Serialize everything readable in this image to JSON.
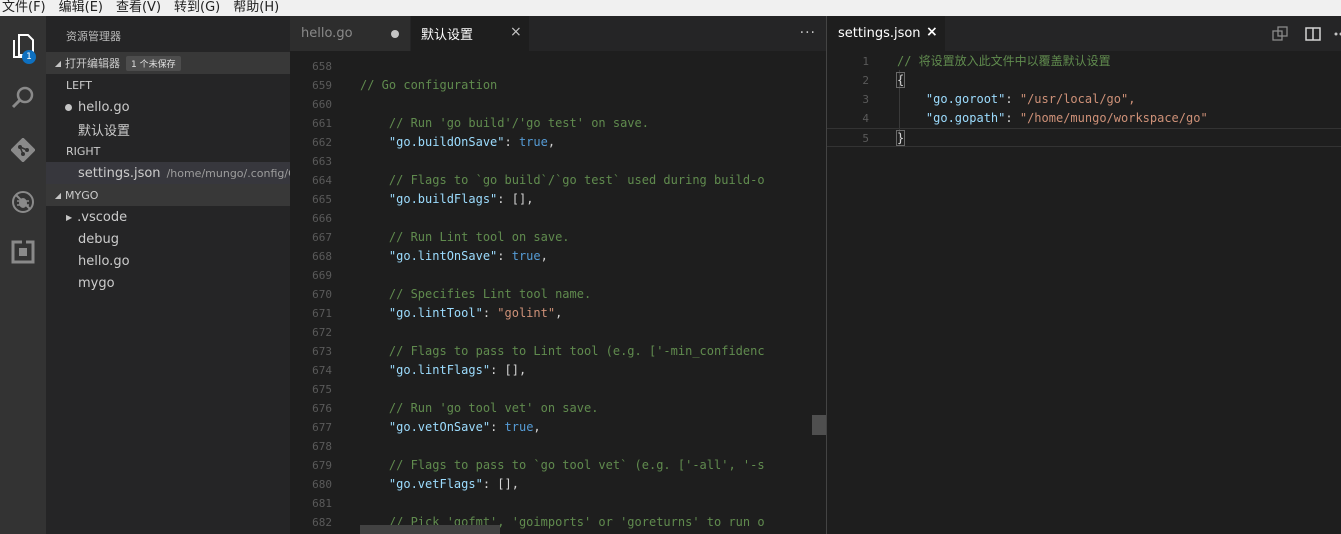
{
  "menu": [
    "文件(F)",
    "编辑(E)",
    "查看(V)",
    "转到(G)",
    "帮助(H)"
  ],
  "activity": {
    "explorer_badge": "1"
  },
  "sidebar": {
    "title": "资源管理器",
    "open_editors": {
      "label": "打开编辑器",
      "badge": "1 个未保存"
    },
    "groups": [
      {
        "label": "LEFT",
        "files": [
          {
            "name": "hello.go",
            "dirty": true
          },
          {
            "name": "默认设置"
          }
        ]
      },
      {
        "label": "RIGHT",
        "files": [
          {
            "name": "settings.json",
            "path": "/home/mungo/.config/C..."
          }
        ]
      }
    ],
    "folder": {
      "label": "MYGO",
      "items": [
        ".vscode",
        "debug",
        "hello.go",
        "mygo"
      ]
    }
  },
  "left_tabs": [
    {
      "label": "hello.go",
      "dirty": true
    },
    {
      "label": "默认设置",
      "close": "×"
    }
  ],
  "left_more": "···",
  "left_code": [
    {
      "n": "658",
      "t": ""
    },
    {
      "n": "659",
      "t": "// Go configuration"
    },
    {
      "n": "660",
      "t": ""
    },
    {
      "n": "661",
      "t": "    // Run 'go build'/'go test' on save."
    },
    {
      "n": "662",
      "key": "\"go.buildOnSave\"",
      "val": "true"
    },
    {
      "n": "663",
      "t": ""
    },
    {
      "n": "664",
      "t": "    // Flags to `go build`/`go test` used during build-o"
    },
    {
      "n": "665",
      "key": "\"go.buildFlags\"",
      "val": "[]"
    },
    {
      "n": "666",
      "t": ""
    },
    {
      "n": "667",
      "t": "    // Run Lint tool on save."
    },
    {
      "n": "668",
      "key": "\"go.lintOnSave\"",
      "val": "true"
    },
    {
      "n": "669",
      "t": ""
    },
    {
      "n": "670",
      "t": "    // Specifies Lint tool name."
    },
    {
      "n": "671",
      "key": "\"go.lintTool\"",
      "val": "\"golint\""
    },
    {
      "n": "672",
      "t": ""
    },
    {
      "n": "673",
      "t": "    // Flags to pass to Lint tool (e.g. ['-min_confidenc"
    },
    {
      "n": "674",
      "key": "\"go.lintFlags\"",
      "val": "[]"
    },
    {
      "n": "675",
      "t": ""
    },
    {
      "n": "676",
      "t": "    // Run 'go tool vet' on save."
    },
    {
      "n": "677",
      "key": "\"go.vetOnSave\"",
      "val": "true"
    },
    {
      "n": "678",
      "t": ""
    },
    {
      "n": "679",
      "t": "    // Flags to pass to `go tool vet` (e.g. ['-all', '-s"
    },
    {
      "n": "680",
      "key": "\"go.vetFlags\"",
      "val": "[]"
    },
    {
      "n": "681",
      "t": ""
    },
    {
      "n": "682",
      "t": "    // Pick 'gofmt', 'goimports' or 'goreturns' to run o"
    }
  ],
  "right_tab": {
    "label": "settings.json",
    "close": "×"
  },
  "right_code": [
    {
      "n": "1",
      "t": "// 将设置放入此文件中以覆盖默认设置"
    },
    {
      "n": "2",
      "t": "{"
    },
    {
      "n": "3",
      "key": "\"go.goroot\"",
      "val": "\"/usr/local/go\","
    },
    {
      "n": "4",
      "key": "\"go.gopath\"",
      "val": "\"/home/mungo/workspace/go\""
    },
    {
      "n": "5",
      "t": "}"
    }
  ]
}
